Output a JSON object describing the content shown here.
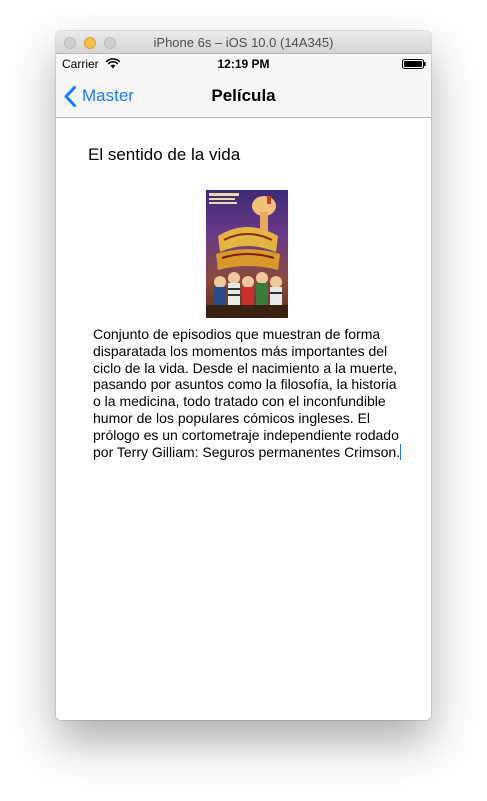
{
  "window": {
    "title": "iPhone 6s – iOS 10.0 (14A345)"
  },
  "status_bar": {
    "carrier": "Carrier",
    "time": "12:19 PM",
    "icons": [
      "wifi-icon",
      "battery-icon"
    ]
  },
  "nav_bar": {
    "back_label": "Master",
    "title": "Película",
    "back_icon": "chevron-left-icon"
  },
  "content": {
    "movie_title": "El sentido de la vida",
    "poster_alt": "movie-poster",
    "description": "Conjunto de episodios que muestran de forma disparatada los momentos más importantes del ciclo de la vida. Desde el nacimiento a la muerte, pasando por asuntos como la filosofía, la historia o la medicina, todo tratado con el inconfundible humor de los populares cómicos ingleses. El prólogo es un cortometraje independiente rodado por Terry Gilliam: Seguros permanentes Crimson."
  },
  "colors": {
    "tint": "#1a7cf6",
    "bar_background": "#f7f7f7",
    "minimize_button": "#f6be4f"
  }
}
